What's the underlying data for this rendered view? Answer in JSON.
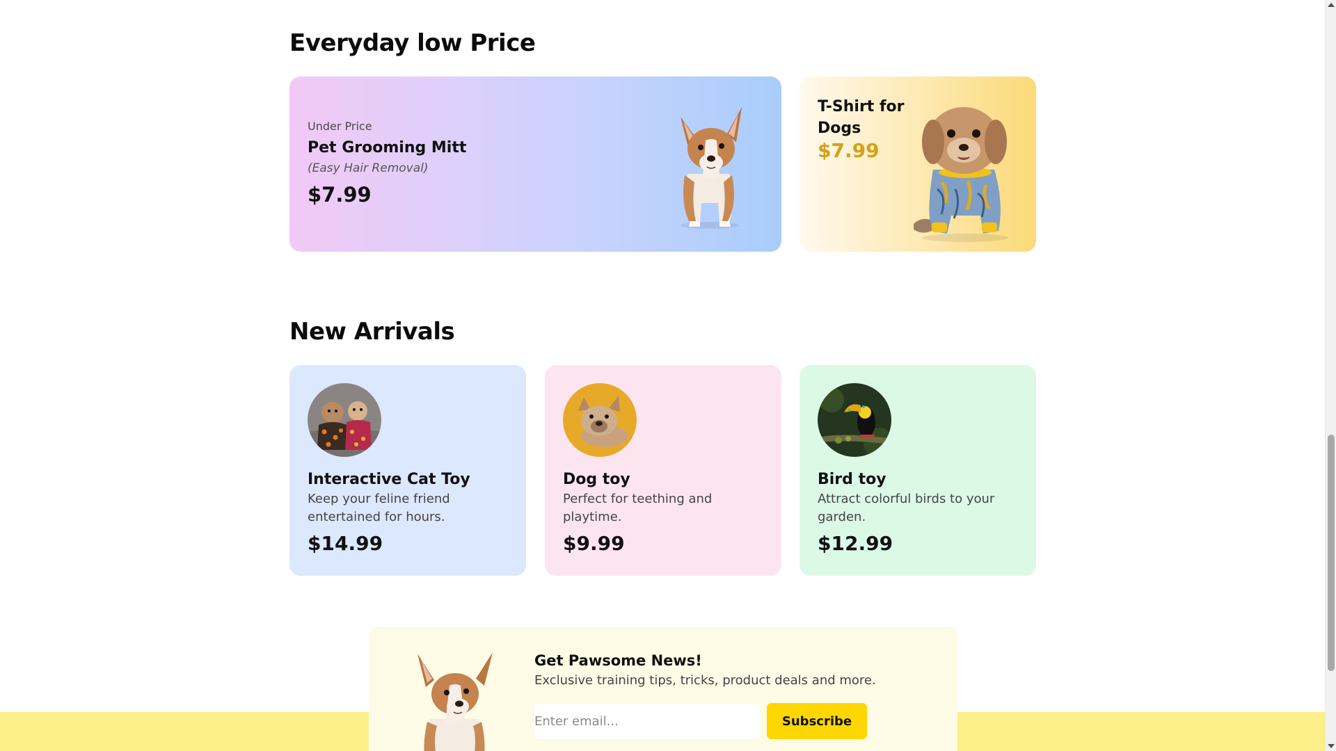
{
  "everyday": {
    "heading": "Everyday low Price",
    "main_deal": {
      "eyebrow": "Under Price",
      "name": "Pet Grooming Mitt",
      "subtitle": "(Easy Hair Removal)",
      "price": "$7.99",
      "image": "corgi-puppy-icon"
    },
    "side_deal": {
      "name": "T-Shirt for Dogs",
      "price": "$7.99",
      "image": "dog-in-shirt-icon"
    }
  },
  "arrivals": {
    "heading": "New Arrivals",
    "items": [
      {
        "name": "Interactive Cat Toy",
        "desc": "Keep your feline friend entertained for hours.",
        "price": "$14.99",
        "image": "dogs-in-pajamas-icon",
        "bg": "#dce8fd"
      },
      {
        "name": "Dog toy",
        "desc": "Perfect for teething and playtime.",
        "price": "$9.99",
        "image": "french-bulldog-icon",
        "bg": "#fde5f0"
      },
      {
        "name": "Bird toy",
        "desc": "Attract colorful birds to your garden.",
        "price": "$12.99",
        "image": "toucan-icon",
        "bg": "#dcf9e6"
      }
    ]
  },
  "newsletter": {
    "title": "Get Pawsome News!",
    "desc": "Exclusive training tips, tricks, product deals and more.",
    "email_placeholder": "Enter email...",
    "button": "Subscribe",
    "image": "corgi-puppy-icon"
  },
  "colors": {
    "accent": "#fed700",
    "footer_band": "#fdef8a",
    "price_gold": "#d4a118"
  }
}
